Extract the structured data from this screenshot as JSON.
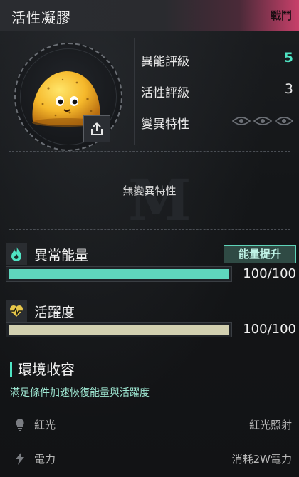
{
  "header": {
    "title": "活性凝膠",
    "tag": "戰鬥"
  },
  "stats": {
    "ability_rating_label": "異能評級",
    "ability_rating_value": "5",
    "activity_rating_label": "活性評級",
    "activity_rating_value": "3",
    "mutation_trait_label": "變異特性"
  },
  "mutation": {
    "empty_text": "無變異特性",
    "watermark": "M"
  },
  "abnormal_energy": {
    "label": "異常能量",
    "boost_label": "能量提升",
    "value_text": "100/100",
    "fill_fraction": 1.0,
    "bar_color": "#5fd6bd"
  },
  "activity": {
    "label": "活躍度",
    "value_text": "100/100",
    "fill_fraction": 1.0,
    "bar_color": "#d2d0b0"
  },
  "environment": {
    "title": "環境收容",
    "subtitle": "滿足條件加速恢復能量與活躍度",
    "rows": [
      {
        "name": "紅光",
        "requirement": "紅光照射",
        "icon": "lightbulb-icon"
      },
      {
        "name": "電力",
        "requirement": "消耗2W電力",
        "icon": "lightning-icon"
      }
    ]
  },
  "colors": {
    "accent": "#4fe3c3",
    "header_tag_bg": "#c8406a"
  }
}
